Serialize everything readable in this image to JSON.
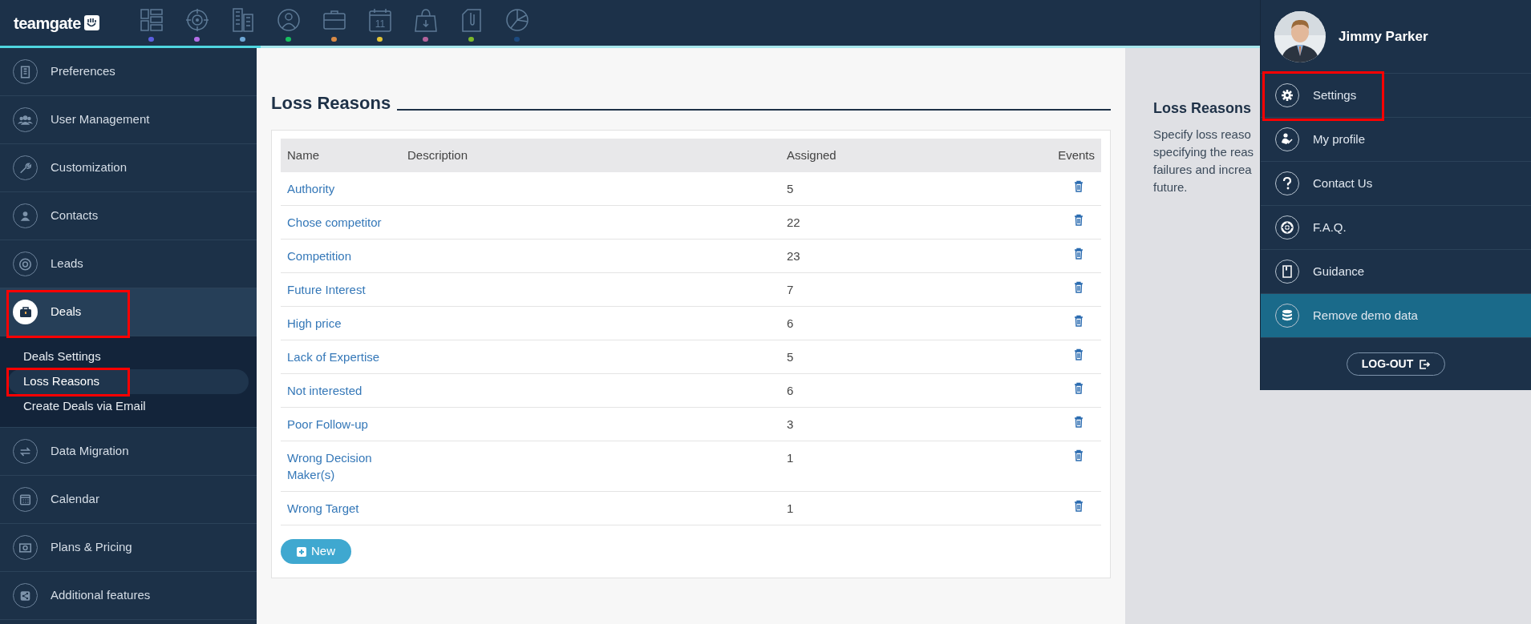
{
  "logo": {
    "text": "teamgate"
  },
  "nav_items": [
    {
      "kind": "dashboard",
      "color": "#5b5fe0"
    },
    {
      "kind": "target",
      "color": "#b46ee8"
    },
    {
      "kind": "buildings",
      "color": "#6ea8d6"
    },
    {
      "kind": "person",
      "color": "#16c060"
    },
    {
      "kind": "briefcase",
      "color": "#d98a46"
    },
    {
      "kind": "calendar",
      "color": "#e3c437",
      "icon_text": "11"
    },
    {
      "kind": "bag",
      "color": "#b4639b"
    },
    {
      "kind": "clip",
      "color": "#7cb82a"
    },
    {
      "kind": "pie",
      "color": "#1c4a80"
    }
  ],
  "sidebar": {
    "items": [
      {
        "label": "Preferences",
        "kind": "building",
        "selected": false,
        "highlighted": false
      },
      {
        "label": "User Management",
        "kind": "users",
        "selected": false,
        "highlighted": false
      },
      {
        "label": "Customization",
        "kind": "wrench",
        "selected": false,
        "highlighted": false
      },
      {
        "label": "Contacts",
        "kind": "person",
        "selected": false,
        "highlighted": false
      },
      {
        "label": "Leads",
        "kind": "target",
        "selected": false,
        "highlighted": false
      },
      {
        "label": "Deals",
        "kind": "briefcase",
        "selected": true,
        "highlighted": true,
        "expanded": true,
        "children": [
          {
            "label": "Deals Settings",
            "selected": false,
            "highlighted": false
          },
          {
            "label": "Loss Reasons",
            "selected": true,
            "highlighted": true
          },
          {
            "label": "Create Deals via Email",
            "selected": false,
            "highlighted": false
          }
        ]
      },
      {
        "label": "Data Migration",
        "kind": "arrows",
        "selected": false,
        "highlighted": false
      },
      {
        "label": "Calendar",
        "kind": "calendar",
        "selected": false,
        "highlighted": false
      },
      {
        "label": "Plans & Pricing",
        "kind": "money",
        "selected": false,
        "highlighted": false
      },
      {
        "label": "Additional features",
        "kind": "share",
        "selected": false,
        "highlighted": false
      }
    ]
  },
  "page": {
    "title": "Loss Reasons",
    "table": {
      "columns": [
        "Name",
        "Description",
        "Assigned",
        "Events"
      ],
      "rows": [
        {
          "name": "Authority",
          "assigned": "5"
        },
        {
          "name": "Chose competitor",
          "assigned": "22"
        },
        {
          "name": "Competition",
          "assigned": "23"
        },
        {
          "name": "Future Interest",
          "assigned": "7"
        },
        {
          "name": "High price",
          "assigned": "6"
        },
        {
          "name": "Lack of Expertise",
          "assigned": "5"
        },
        {
          "name": "Not interested",
          "assigned": "6"
        },
        {
          "name": "Poor Follow-up",
          "assigned": "3"
        },
        {
          "name": "Wrong Decision Maker(s)",
          "assigned": "1"
        },
        {
          "name": "Wrong Target",
          "assigned": "1"
        }
      ]
    },
    "new_button": "New"
  },
  "info_panel": {
    "title": "Loss Reasons",
    "lines": [
      "Specify loss reaso",
      "specifying the reas",
      "failures and increa",
      "future."
    ]
  },
  "user_menu": {
    "name": "Jimmy Parker",
    "items": [
      {
        "label": "Settings",
        "kind": "gear",
        "highlighted": true,
        "selected": false
      },
      {
        "label": "My profile",
        "kind": "profile",
        "highlighted": false,
        "selected": false
      },
      {
        "label": "Contact Us",
        "kind": "question",
        "highlighted": false,
        "selected": false
      },
      {
        "label": "F.A.Q.",
        "kind": "lifebuoy",
        "highlighted": false,
        "selected": false
      },
      {
        "label": "Guidance",
        "kind": "book",
        "highlighted": false,
        "selected": false
      },
      {
        "label": "Remove demo data",
        "kind": "database",
        "highlighted": false,
        "selected": true
      }
    ],
    "logout": "LOG-OUT"
  }
}
